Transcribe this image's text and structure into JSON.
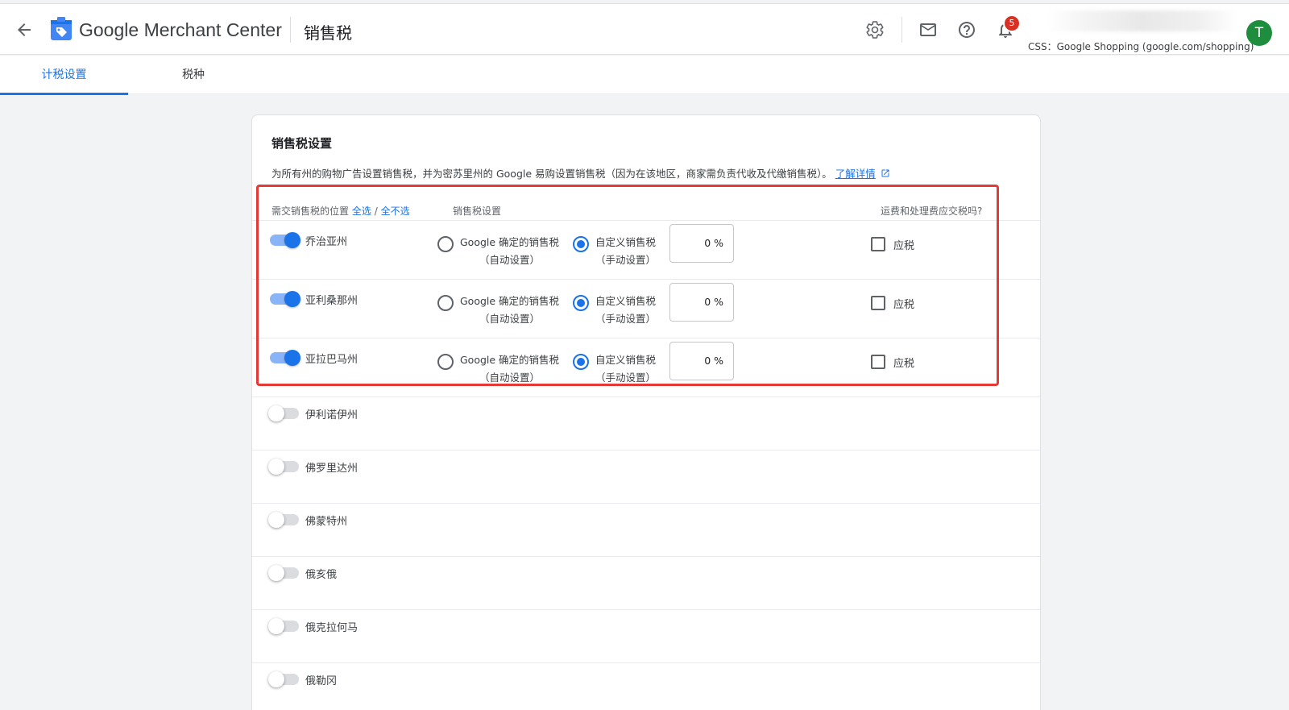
{
  "header": {
    "brand_google": "Google",
    "brand_rest": "Merchant Center",
    "page_title": "销售税",
    "notification_count": "5",
    "css_line": "CSS：Google Shopping (google.com/shopping)",
    "avatar_letter": "T"
  },
  "tabs": [
    {
      "label": "计税设置",
      "active": true
    },
    {
      "label": "税种",
      "active": false
    }
  ],
  "card": {
    "title": "销售税设置",
    "description": "为所有州的购物广告设置销售税，并为密苏里州的 Google 易购设置销售税（因为在该地区，商家需负责代收及代缴销售税）。",
    "learn_more": "了解详情",
    "col_location": "需交销售税的位置",
    "select_all": "全选",
    "separator": "/",
    "select_none": "全不选",
    "col_setting": "销售税设置",
    "col_shipping": "运费和处理费应交税吗?"
  },
  "option_labels": {
    "google_line1": "Google 确定的销售税",
    "google_line2": "（自动设置）",
    "custom_line1": "自定义销售税",
    "custom_line2": "（手动设置）",
    "taxable": "应税"
  },
  "states_enabled": [
    {
      "name": "乔治亚州",
      "enabled": true,
      "rate": "0 %",
      "mode": "custom",
      "shipping_taxable": false
    },
    {
      "name": "亚利桑那州",
      "enabled": true,
      "rate": "0 %",
      "mode": "custom",
      "shipping_taxable": false
    },
    {
      "name": "亚拉巴马州",
      "enabled": true,
      "rate": "0 %",
      "mode": "custom",
      "shipping_taxable": false
    }
  ],
  "states_disabled": [
    {
      "name": "伊利诺伊州",
      "enabled": false
    },
    {
      "name": "佛罗里达州",
      "enabled": false
    },
    {
      "name": "佛蒙特州",
      "enabled": false
    },
    {
      "name": "俄亥俄",
      "enabled": false
    },
    {
      "name": "俄克拉何马",
      "enabled": false
    },
    {
      "name": "俄勒冈",
      "enabled": false
    }
  ],
  "colors": {
    "accent": "#1a73e8",
    "highlight_box": "#e53935",
    "badge": "#d93025",
    "avatar": "#1e8e3e"
  },
  "icons": [
    "arrow-back-icon",
    "merchant-center-logo",
    "settings-gear-icon",
    "mail-icon",
    "help-icon",
    "notifications-bell-icon",
    "open-in-new-icon"
  ]
}
